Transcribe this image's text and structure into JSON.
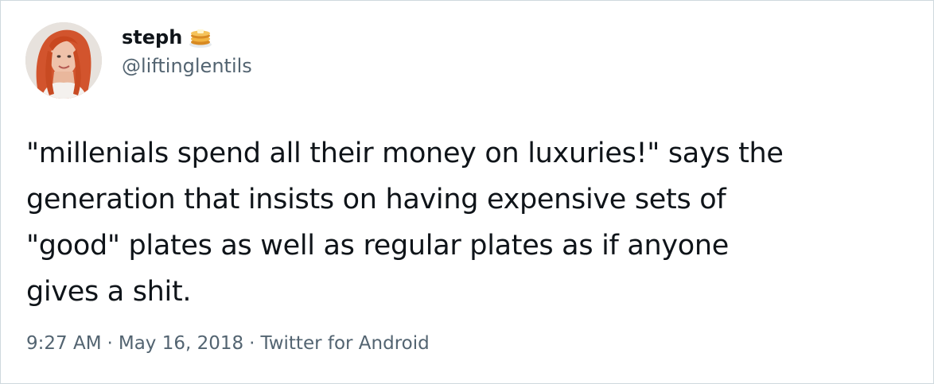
{
  "user": {
    "display_name": "steph",
    "handle": "@liftinglentils",
    "name_emoji_icon": "pancakes-emoji-icon"
  },
  "tweet": {
    "text": "\"millenials spend all their money on luxuries!\" says the\ngeneration that insists on having expensive sets of\n\"good\" plates as well as regular plates as if anyone\ngives a shit."
  },
  "meta": {
    "time": "9:27 AM",
    "separator": "·",
    "date": "May 16, 2018",
    "source": "Twitter for Android"
  },
  "colors": {
    "text_primary": "#0f1419",
    "text_secondary": "#536471",
    "border": "#cfd9de"
  }
}
